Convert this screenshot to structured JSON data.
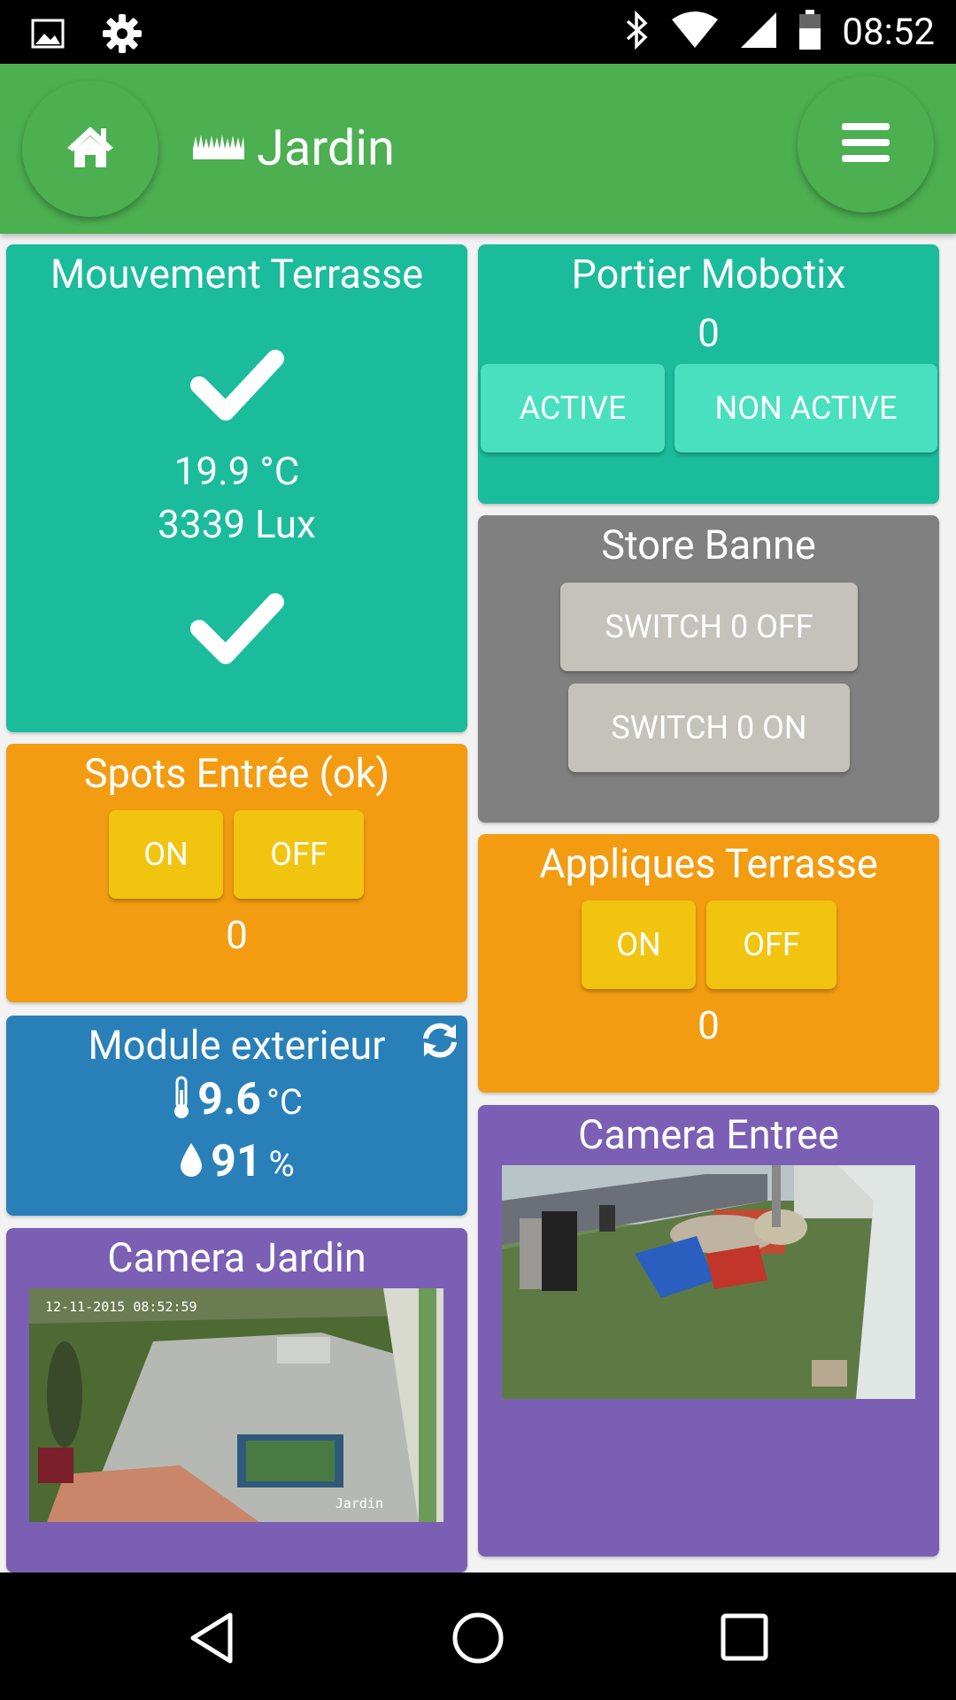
{
  "status_bar": {
    "time": "08:52",
    "icons_left": [
      "image-icon",
      "settings-gear-icon"
    ],
    "icons_right": [
      "bluetooth-icon",
      "wifi-icon",
      "signal-icon",
      "battery-icon"
    ]
  },
  "header": {
    "title": "Jardin",
    "color": "#4caf50",
    "icons": [
      "home-icon",
      "grass-icon",
      "menu-icon"
    ]
  },
  "widgets": {
    "mouvement": {
      "title": "Mouvement Terrasse",
      "temperature": "19.9 °C",
      "lux": "3339 Lux",
      "color": "#1abc9c"
    },
    "portier": {
      "title": "Portier Mobotix",
      "value": "0",
      "active_label": "ACTIVE",
      "non_active_label": "NON ACTIVE",
      "color": "#1abc9c"
    },
    "store": {
      "title": "Store Banne",
      "off_label": "SWITCH 0 OFF",
      "on_label": "SWITCH 0 ON",
      "color": "#808080"
    },
    "spots": {
      "title": "Spots Entrée (ok)",
      "on_label": "ON",
      "off_label": "OFF",
      "value": "0",
      "color": "#f39c12"
    },
    "appliques": {
      "title": "Appliques Terrasse",
      "on_label": "ON",
      "off_label": "OFF",
      "value": "0",
      "color": "#f39c12"
    },
    "module": {
      "title": "Module exterieur",
      "temperature": "9.6",
      "temperature_unit": "°C",
      "humidity": "91",
      "humidity_unit": "%",
      "color": "#2980b9"
    },
    "camera_jardin": {
      "title": "Camera Jardin",
      "timestamp": "12-11-2015 08:52:59",
      "overlay_label": "Jardin",
      "color": "#7b5fb4"
    },
    "camera_entree": {
      "title": "Camera Entree",
      "color": "#7b5fb4"
    }
  }
}
